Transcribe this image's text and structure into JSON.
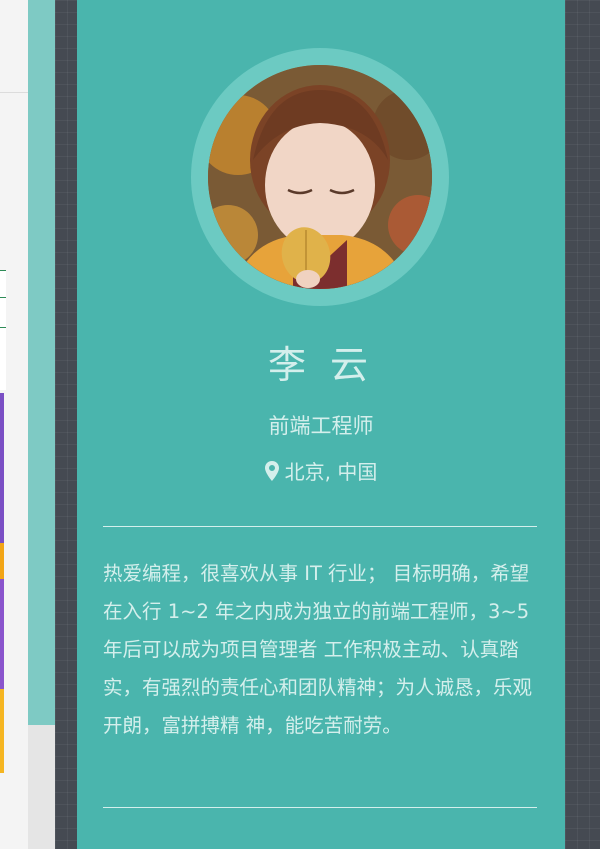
{
  "profile": {
    "name": "李 云",
    "title": "前端工程师",
    "location": "北京, 中国",
    "bio": "热爱编程，很喜欢从事 IT 行业； 目标明确，希望在入行 1~2 年之内成为独立的前端工程师，3~5 年后可以成为项目管理者 工作积极主动、认真踏实，有强烈的责任心和团队精神；为人诚恳，乐观开朗，富拼搏精 神，能吃苦耐劳。"
  },
  "icons": {
    "location": "map-marker-icon"
  },
  "colors": {
    "card_background": "#4ab5ad",
    "avatar_ring": "#6ccac2",
    "text": "#d4efec",
    "side_pattern": "#454a52"
  }
}
